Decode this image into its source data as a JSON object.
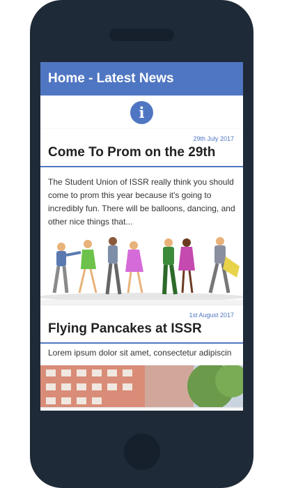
{
  "appbar": {
    "title": "Home - Latest News"
  },
  "info": {
    "icon": "info-icon",
    "label": "i"
  },
  "articles": [
    {
      "date": "29th July 2017",
      "title": "Come To Prom on the 29th",
      "excerpt": "The Student Union of ISSR really think you should come to prom this year because it's going to incredibly fun. There will be balloons, dancing, and other nice things that...",
      "image": "dancing-couples-illustration"
    },
    {
      "date": "1st August 2017",
      "title": "Flying Pancakes at ISSR",
      "excerpt": "Lorem ipsum dolor sit amet, consectetur adipiscin",
      "image": "building-photo"
    }
  ],
  "colors": {
    "accent": "#4f76c2",
    "phone": "#1f2a38"
  }
}
